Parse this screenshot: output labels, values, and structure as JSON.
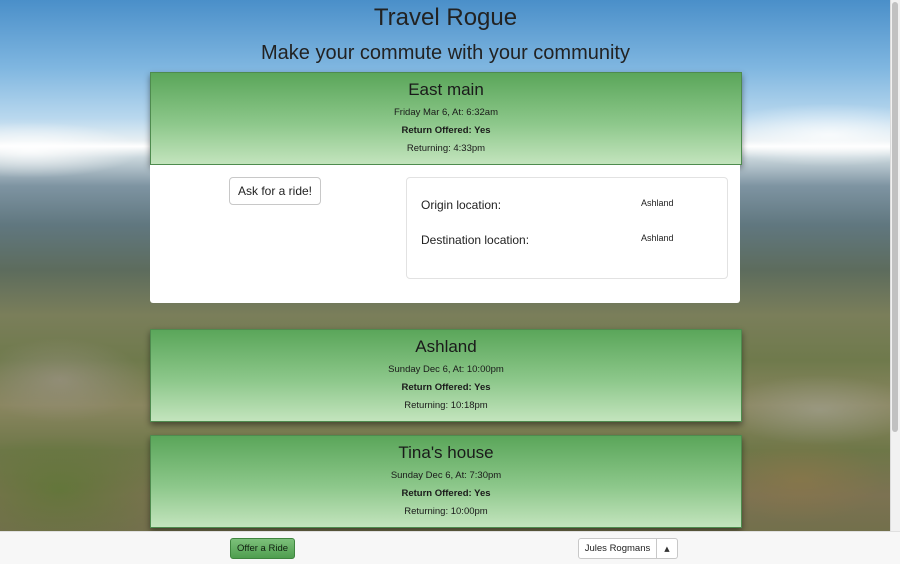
{
  "header": {
    "title": "Travel Rogue",
    "subtitle": "Make your commute with your community"
  },
  "rides": [
    {
      "destination": "East main",
      "date_line": "Friday Mar 6, At: 6:32am",
      "return_offered": "Return Offered: Yes",
      "returning": "Returning: 4:33pm",
      "expanded": true
    },
    {
      "destination": "Ashland",
      "date_line": "Sunday Dec 6, At: 10:00pm",
      "return_offered": "Return Offered: Yes",
      "returning": "Returning: 10:18pm",
      "expanded": false
    },
    {
      "destination": "Tina's house",
      "date_line": "Sunday Dec 6, At: 7:30pm",
      "return_offered": "Return Offered: Yes",
      "returning": "Returning: 10:00pm",
      "expanded": false
    }
  ],
  "details": {
    "ask_button": "Ask for a ride!",
    "origin_label": "Origin location:",
    "origin_value": "Ashland",
    "destination_label": "Destination location:",
    "destination_value": "Ashland"
  },
  "footer": {
    "offer_button": "Offer a Ride",
    "user_name": "Jules Rogmans",
    "caret_icon": "caret-up-icon"
  },
  "colors": {
    "card_green_top": "#5aa65a",
    "card_green_bottom": "#c3e4bd",
    "offer_button_green": "#4f9e4f"
  }
}
